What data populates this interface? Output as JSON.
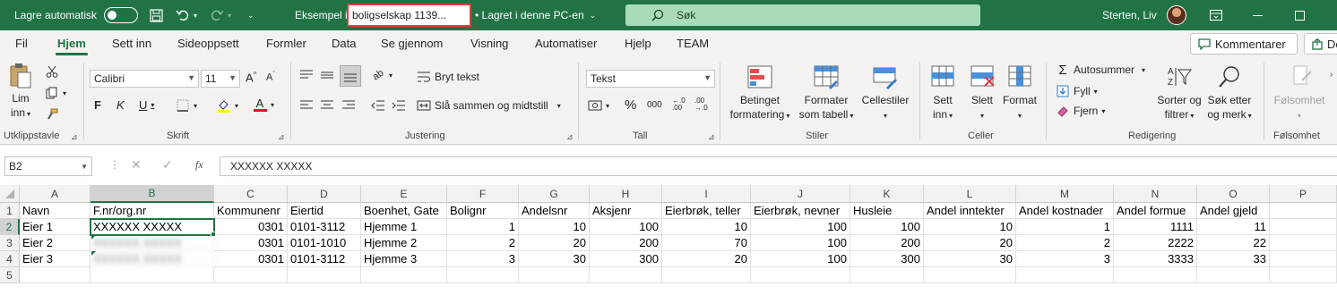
{
  "titlebar": {
    "autosave_label": "Lagre automatisk",
    "file_name_prefix": "Eksempel impor",
    "file_name_highlight": "boligselskap 1139...",
    "save_status": "• Lagret i denne PC-en",
    "search_placeholder": "Søk",
    "user_name": "Sterten, Liv"
  },
  "menu": {
    "tabs": [
      "Fil",
      "Hjem",
      "Sett inn",
      "Sideoppsett",
      "Formler",
      "Data",
      "Se gjennom",
      "Visning",
      "Automatiser",
      "Hjelp",
      "TEAM"
    ],
    "active_tab": "Hjem",
    "comments_button": "Kommentarer",
    "share_button": "De"
  },
  "ribbon": {
    "clipboard": {
      "paste_label_1": "Lim",
      "paste_label_2": "inn",
      "group_label": "Utklippstavle"
    },
    "font": {
      "font_name": "Calibri",
      "font_size": "11",
      "bold": "F",
      "italic": "K",
      "underline": "U",
      "group_label": "Skrift"
    },
    "alignment": {
      "wrap_text": "Bryt tekst",
      "merge_center": "Slå sammen og midtstill",
      "group_label": "Justering"
    },
    "number": {
      "format": "Tekst",
      "percent": "%",
      "comma": "000",
      "group_label": "Tall"
    },
    "styles": {
      "conditional_1": "Betinget",
      "conditional_2": "formatering",
      "table_1": "Formater",
      "table_2": "som tabell",
      "cell_styles": "Cellestiler",
      "group_label": "Stiler"
    },
    "cells": {
      "insert_1": "Sett",
      "insert_2": "inn",
      "delete": "Slett",
      "format": "Format",
      "group_label": "Celler"
    },
    "editing": {
      "autosum": "Autosummer",
      "fill": "Fyll",
      "clear": "Fjern",
      "sort_1": "Sorter og",
      "sort_2": "filtrer",
      "find_1": "Søk etter",
      "find_2": "og merk",
      "group_label": "Redigering"
    },
    "sensitivity": {
      "label": "Følsomhet",
      "group_label": "Følsomhet"
    }
  },
  "formula_bar": {
    "name_box": "B2",
    "fx": "fx",
    "value": "XXXXXX XXXXX"
  },
  "sheet": {
    "columns": [
      "A",
      "B",
      "C",
      "D",
      "E",
      "F",
      "G",
      "H",
      "I",
      "J",
      "K",
      "L",
      "M",
      "N",
      "O",
      "P"
    ],
    "rows_numbers": [
      "1",
      "2",
      "3",
      "4",
      "5"
    ],
    "selected_column": "B",
    "selected_row": "2",
    "header_row": [
      "Navn",
      "F.nr/org.nr",
      "Kommunenr",
      "Eiertid",
      "Boenhet, Gate",
      "Bolignr",
      "Andelsnr",
      "Aksjenr",
      "Eierbrøk, teller",
      "Eierbrøk, nevner",
      "Husleie",
      "Andel inntekter",
      "Andel kostnader",
      "Andel formue",
      "Andel gjeld",
      ""
    ],
    "data_rows": [
      [
        "Eier 1",
        "XXXXXX XXXXX",
        "0301",
        "0101-3112",
        "Hjemme 1",
        "1",
        "10",
        "100",
        "10",
        "100",
        "100",
        "10",
        "1",
        "1111",
        "11",
        ""
      ],
      [
        "Eier 2",
        "XXXXXX XXXXX",
        "0301",
        "0101-1010",
        "Hjemme 2",
        "2",
        "20",
        "200",
        "70",
        "100",
        "200",
        "20",
        "2",
        "2222",
        "22",
        ""
      ],
      [
        "Eier 3",
        "XXXXXX XXXXX",
        "0301",
        "0101-3112",
        "Hjemme 3",
        "3",
        "30",
        "300",
        "20",
        "100",
        "300",
        "30",
        "3",
        "3333",
        "33",
        ""
      ]
    ]
  },
  "colors": {
    "excel_green": "#217346",
    "highlight_red": "#e03a3a"
  }
}
